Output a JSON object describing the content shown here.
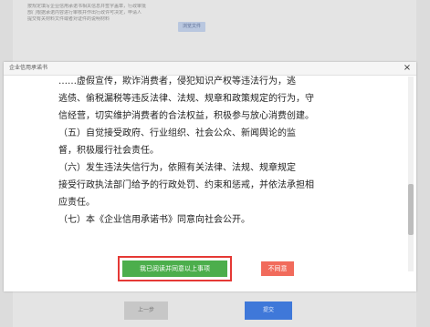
{
  "background": {
    "notice_lines": [
      "按规定填写企业信用承诺书相关信息并签字盖章，行政审批",
      "部门根据承诺内容进行审核并作出行政许可决定，申请人",
      "提交有关材料文件或者对证件的说明材料"
    ],
    "file_button_label": "浏览文件",
    "prev_button_label": "上一步",
    "submit_button_label": "提交"
  },
  "modal": {
    "title": "企业信用承诺书",
    "close_label": "×",
    "paragraphs": [
      "……虚假宣传，欺诈消费者，侵犯知识产权等违法行为，逃",
      "逃债、偷税漏税等违反法律、法规、规章和政策规定的行为，守",
      "信经营，切实维护消费者的合法权益，积极参与放心消费创建。",
      "（五）自觉接受政府、行业组织、社会公众、新闻舆论的监",
      "督，积极履行社会责任。",
      "（六）发生违法失信行为，依照有关法律、法规、规章规定",
      "接受行政执法部门给予的行政处罚、约束和惩戒，并依法承担相",
      "应责任。",
      "（七）本《企业信用承诺书》同意向社会公开。"
    ],
    "agree_button_label": "我已阅读并同意以上事项",
    "disagree_button_label": "不同意"
  },
  "colors": {
    "agree_green": "#4cae4c",
    "disagree_red": "#f16b5c",
    "highlight_red": "#e53935",
    "submit_blue": "#3f78d9"
  }
}
